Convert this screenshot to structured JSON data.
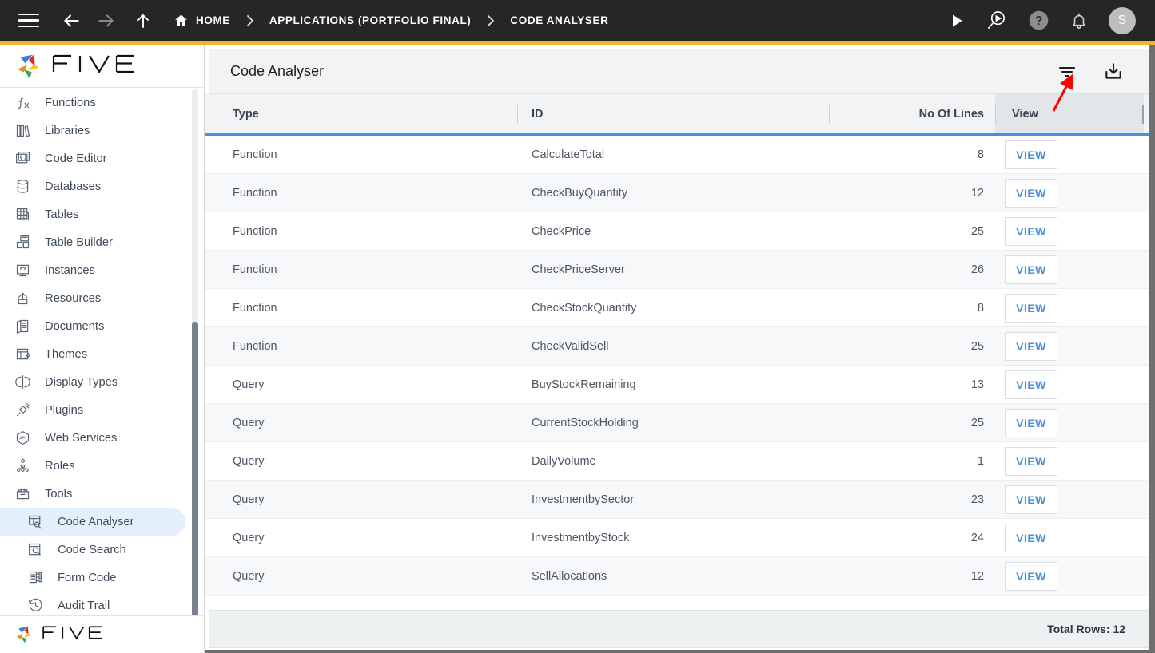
{
  "topbar": {
    "menu_icon": "hamburger-icon",
    "back_icon": "arrow-left-icon",
    "forward_icon": "arrow-right-icon",
    "up_icon": "arrow-up-icon",
    "home_label": "HOME",
    "separator": "›",
    "breadcrumbs": [
      {
        "label": "APPLICATIONS (PORTFOLIO FINAL)"
      },
      {
        "label": "CODE ANALYSER"
      }
    ],
    "actions": [
      {
        "name": "run-icon"
      },
      {
        "name": "debug-run-icon"
      },
      {
        "name": "help-icon"
      },
      {
        "name": "notifications-icon"
      }
    ],
    "avatar_initial": "S",
    "background": "#262626",
    "accent": "#F2B32E"
  },
  "sidebar": {
    "logo_text": "FIVE",
    "items": [
      {
        "label": "Functions",
        "icon": "functions-icon",
        "level": 0,
        "active": false
      },
      {
        "label": "Libraries",
        "icon": "libraries-icon",
        "level": 0,
        "active": false
      },
      {
        "label": "Code Editor",
        "icon": "code-editor-icon",
        "level": 0,
        "active": false
      },
      {
        "label": "Databases",
        "icon": "database-icon",
        "level": 0,
        "active": false
      },
      {
        "label": "Tables",
        "icon": "table-icon",
        "level": 0,
        "active": false
      },
      {
        "label": "Table Builder",
        "icon": "table-builder-icon",
        "level": 0,
        "active": false
      },
      {
        "label": "Instances",
        "icon": "instances-icon",
        "level": 0,
        "active": false
      },
      {
        "label": "Resources",
        "icon": "resources-icon",
        "level": 0,
        "active": false
      },
      {
        "label": "Documents",
        "icon": "documents-icon",
        "level": 0,
        "active": false
      },
      {
        "label": "Themes",
        "icon": "themes-icon",
        "level": 0,
        "active": false
      },
      {
        "label": "Display Types",
        "icon": "display-types-icon",
        "level": 0,
        "active": false
      },
      {
        "label": "Plugins",
        "icon": "plugins-icon",
        "level": 0,
        "active": false
      },
      {
        "label": "Web Services",
        "icon": "api-icon",
        "level": 0,
        "active": false
      },
      {
        "label": "Roles",
        "icon": "roles-icon",
        "level": 0,
        "active": false
      },
      {
        "label": "Tools",
        "icon": "tools-icon",
        "level": 0,
        "active": false
      },
      {
        "label": "Code Analyser",
        "icon": "code-analyser-icon",
        "level": 1,
        "active": true
      },
      {
        "label": "Code Search",
        "icon": "code-search-icon",
        "level": 1,
        "active": false
      },
      {
        "label": "Form Code",
        "icon": "form-code-icon",
        "level": 1,
        "active": false
      },
      {
        "label": "Audit Trail",
        "icon": "audit-trail-icon",
        "level": 1,
        "active": false
      }
    ],
    "active_highlight": "#e3effb"
  },
  "panel": {
    "title": "Code Analyser",
    "filter_icon": "filter-icon",
    "download_icon": "download-icon"
  },
  "table": {
    "columns": [
      {
        "key": "type",
        "label": "Type",
        "align": "left"
      },
      {
        "key": "id",
        "label": "ID",
        "align": "left"
      },
      {
        "key": "lines",
        "label": "No Of Lines",
        "align": "right"
      },
      {
        "key": "view",
        "label": "View",
        "align": "left"
      }
    ],
    "view_button_label": "VIEW",
    "rows": [
      {
        "type": "Function",
        "id": "CalculateTotal",
        "lines": "8"
      },
      {
        "type": "Function",
        "id": "CheckBuyQuantity",
        "lines": "12"
      },
      {
        "type": "Function",
        "id": "CheckPrice",
        "lines": "25"
      },
      {
        "type": "Function",
        "id": "CheckPriceServer",
        "lines": "26"
      },
      {
        "type": "Function",
        "id": "CheckStockQuantity",
        "lines": "8"
      },
      {
        "type": "Function",
        "id": "CheckValidSell",
        "lines": "25"
      },
      {
        "type": "Query",
        "id": "BuyStockRemaining",
        "lines": "13"
      },
      {
        "type": "Query",
        "id": "CurrentStockHolding",
        "lines": "25"
      },
      {
        "type": "Query",
        "id": "DailyVolume",
        "lines": "1"
      },
      {
        "type": "Query",
        "id": "InvestmentbySector",
        "lines": "23"
      },
      {
        "type": "Query",
        "id": "InvestmentbyStock",
        "lines": "24"
      },
      {
        "type": "Query",
        "id": "SellAllocations",
        "lines": "12"
      }
    ],
    "footer_total": "Total Rows: 12",
    "header_underline_color": "#4a90d9",
    "link_color": "#4a90d9"
  },
  "annotation": {
    "arrow_color": "#ff0000",
    "points_to": "filter-icon"
  }
}
